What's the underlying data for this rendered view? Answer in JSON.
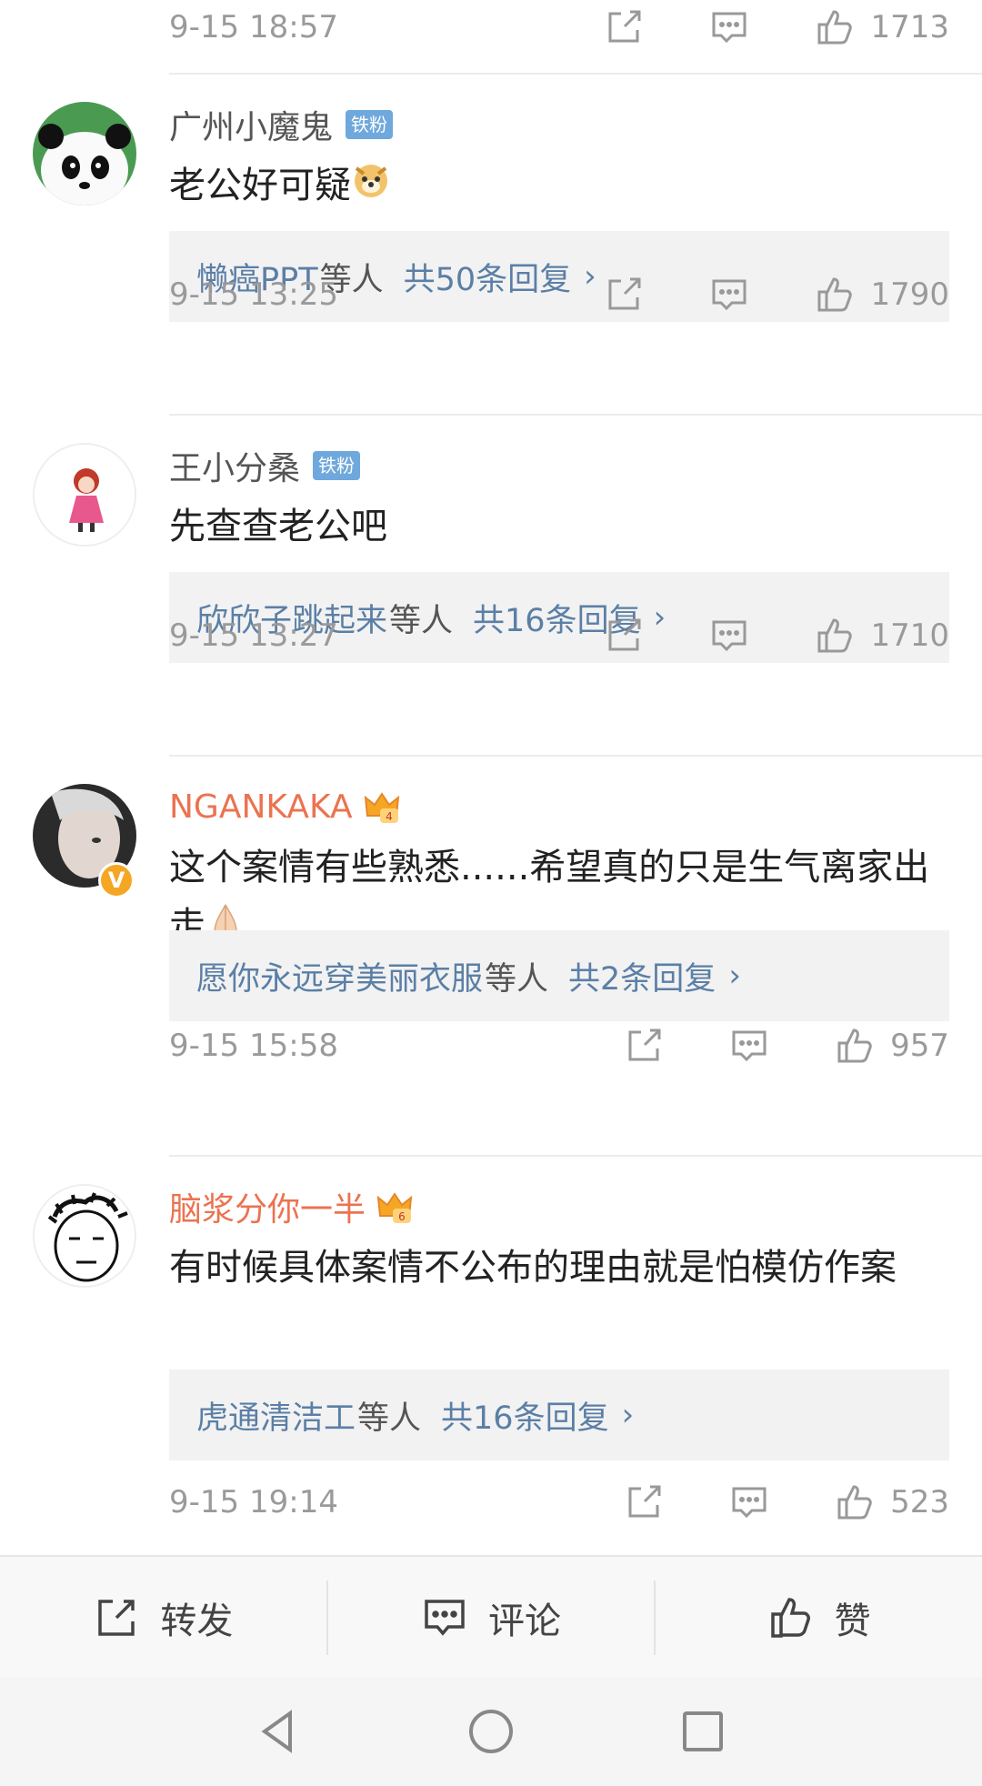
{
  "top_row": {
    "time": "9-15 18:57",
    "likes": "1713"
  },
  "comments": [
    {
      "user": "广州小魔鬼",
      "badge": "铁粉",
      "text": "老公好可疑",
      "reply_names": "懒癌PPT",
      "reply_suffix": "等人",
      "reply_count": "共50条回复",
      "time": "9-15 13:25",
      "likes": "1790"
    },
    {
      "user": "王小分桑",
      "badge": "铁粉",
      "text": "先查查老公吧",
      "reply_names": "欣欣子跳起来",
      "reply_suffix": "等人",
      "reply_count": "共16条回复",
      "time": "9-15 13:27",
      "likes": "1710"
    },
    {
      "user": "NGANKAKA",
      "badge": "",
      "text": "这个案情有些熟悉......希望真的只是生气离家出走",
      "reply_names": "愿你永远穿美丽衣服",
      "reply_suffix": "等人",
      "reply_count": "共2条回复",
      "time": "9-15 15:58",
      "likes": "957"
    },
    {
      "user": "脑浆分你一半",
      "badge": "",
      "text": "有时候具体案情不公布的理由就是怕模仿作案",
      "reply_names": "虎通清洁工",
      "reply_suffix": "等人",
      "reply_count": "共16条回复",
      "time": "9-15 19:14",
      "likes": "523"
    }
  ],
  "actionbar": {
    "repost": "转发",
    "comment": "评论",
    "like": "赞"
  },
  "colors": {
    "link": "#5b7fa6",
    "vip_name": "#eb7350",
    "fan_badge": "#6fa8dc",
    "verify": "#f5a623"
  }
}
